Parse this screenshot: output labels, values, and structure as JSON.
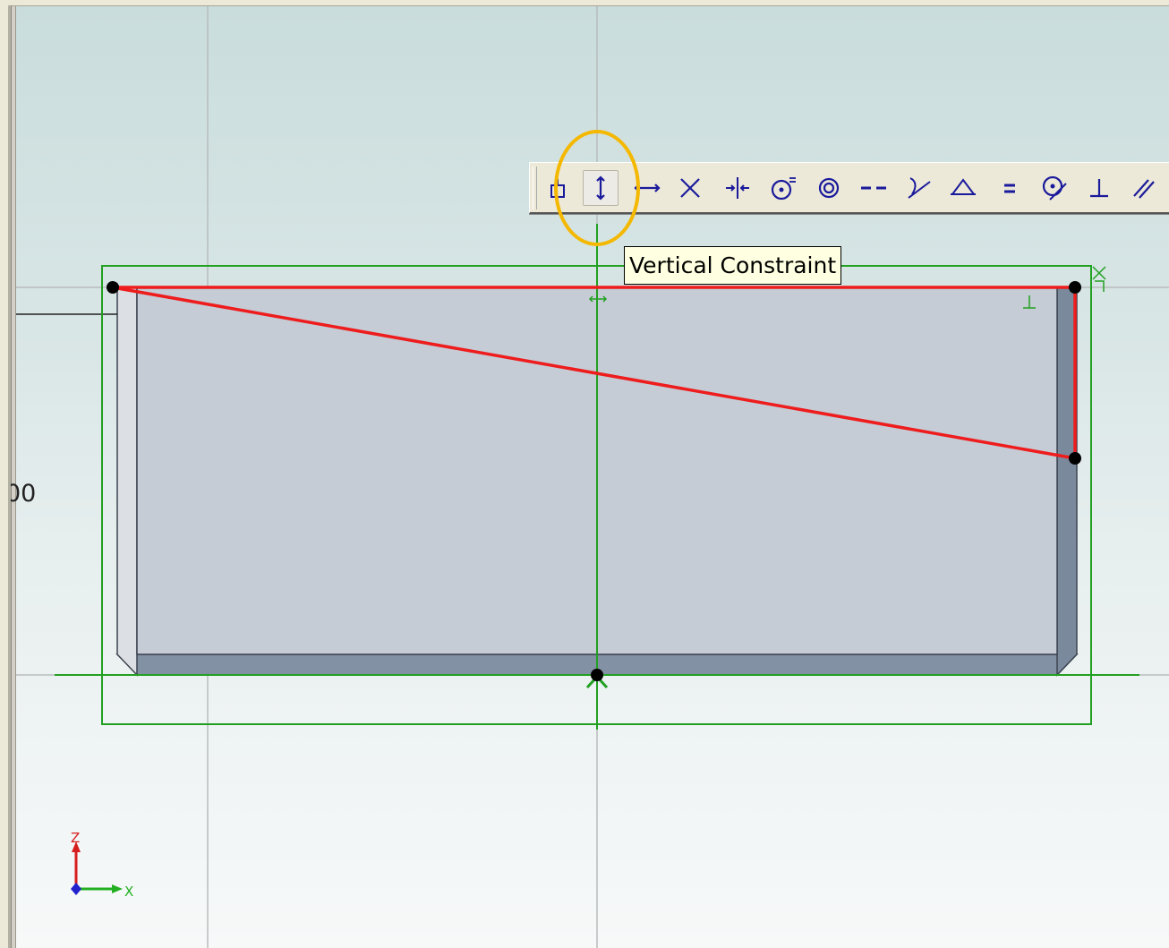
{
  "tooltip": {
    "text": "Vertical Constraint"
  },
  "dimension": {
    "partial_text": "00"
  },
  "axis_triad": {
    "vertical_label": "Z",
    "horizontal_label": "X"
  },
  "toolbar": {
    "active_index": 1,
    "buttons": [
      {
        "name": "anchor-constraint",
        "icon": "anchor-icon"
      },
      {
        "name": "vertical-constraint",
        "icon": "vertical-arrow-icon"
      },
      {
        "name": "horizontal-constraint",
        "icon": "horizontal-arrow-icon"
      },
      {
        "name": "coincident-constraint",
        "icon": "cross-icon"
      },
      {
        "name": "midpoint-constraint",
        "icon": "midpoint-icon"
      },
      {
        "name": "concentric-constraint",
        "icon": "concentric-equal-icon"
      },
      {
        "name": "concentric-arcs-constraint",
        "icon": "concentric-icon"
      },
      {
        "name": "collinear-constraint",
        "icon": "dashed-line-icon"
      },
      {
        "name": "tangent-constraint",
        "icon": "tangent-icon"
      },
      {
        "name": "symmetric-constraint",
        "icon": "symmetric-icon"
      },
      {
        "name": "equal-constraint",
        "icon": "equal-icon"
      },
      {
        "name": "on-curve-constraint",
        "icon": "point-on-circle-icon"
      },
      {
        "name": "perpendicular-constraint",
        "icon": "perpendicular-icon"
      },
      {
        "name": "parallel-constraint",
        "icon": "parallel-icon"
      }
    ]
  },
  "colors": {
    "sketch_line": "#ee1c1c",
    "constraint_green": "#22a022",
    "part_face": "#c5ccd6",
    "highlight": "#f5b800",
    "tooltip_bg": "#ffffe1"
  }
}
